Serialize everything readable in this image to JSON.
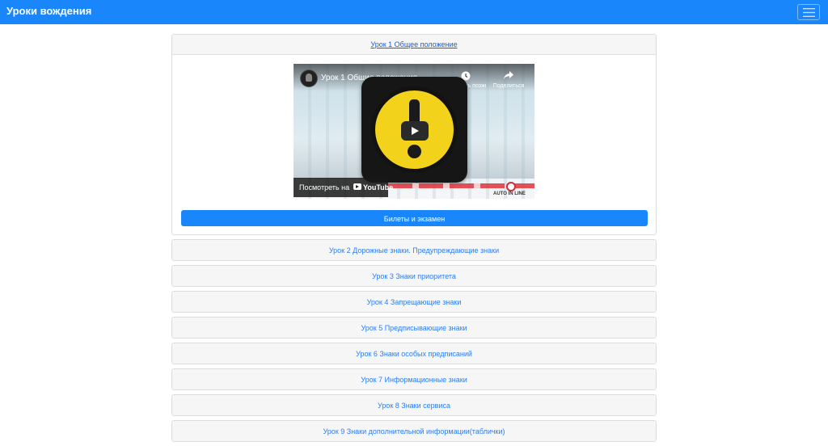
{
  "navbar": {
    "brand": "Уроки вождения",
    "toggler_icon": "hamburger-icon"
  },
  "lesson_1": {
    "title": "Урок 1 Общее положение",
    "video": {
      "title": "Урок 1 Общие положения",
      "watch_later": "Смотреть позже",
      "share": "Поделиться",
      "watch_on": "Посмотреть на",
      "youtube": "YouTube",
      "brand": "AUTO IN LINE"
    },
    "exam_button": "Билеты и экзамен"
  },
  "lessons": [
    {
      "title": "Урок 2 Дорожные знаки. Предупреждающие знаки"
    },
    {
      "title": "Урок 3 Знаки приоритета"
    },
    {
      "title": "Урок 4 Запрещающие знаки"
    },
    {
      "title": "Урок 5 Предписывающие знаки"
    },
    {
      "title": "Урок 6 Знаки особых предписаний"
    },
    {
      "title": "Урок 7 Информационные знаки"
    },
    {
      "title": "Урок 8 Знаки сервиса"
    },
    {
      "title": "Урок 9 Знаки дополнительной информации(таблички)"
    }
  ],
  "colors": {
    "primary": "#1a86fb",
    "link": "#2b7df5",
    "header_bg": "#f6f6f6"
  }
}
